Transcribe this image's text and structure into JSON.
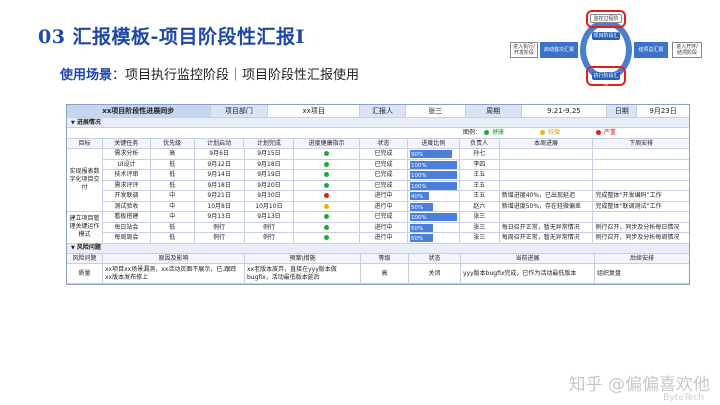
{
  "slide": {
    "title": "03 汇报模板-项目阶段性汇报I",
    "subtitle_label": "使用场景",
    "subtitle_text": "：项目执行监控阶段｜项目阶段性汇报使用",
    "watermark": "知乎 @偏偏喜欢他",
    "watermark_sub": "ByteTech"
  },
  "diagram": {
    "left_box": "进入执行/开发阶段",
    "start_label": "启动首次汇报",
    "top_label": "监控过程阶",
    "ring_top": "项目阶段汇报",
    "ring_bottom": "执行阶段汇报",
    "bottom_label": "执行阶段汇报",
    "end_label": "结项总汇报",
    "right_box": "进入开环/结项阶段"
  },
  "header": {
    "sheet_title": "xx项目阶段性进展同步",
    "dept_label": "项目部门",
    "dept_value": "xx项目",
    "reporter_label": "汇报人",
    "reporter_value": "张三",
    "period_label": "周期",
    "period_value": "9.21-9.25",
    "date_label": "日期",
    "date_value": "9月23日"
  },
  "progress_section": {
    "title": "进展情况",
    "legend_label": "图例：",
    "legend_green": "健康",
    "legend_yellow": "轻微",
    "legend_red": "严重",
    "columns": [
      "目标",
      "关键任务",
      "优先级",
      "计划启动",
      "计划完成",
      "进度健康指示",
      "状态",
      "进度比例",
      "负责人",
      "本周进展",
      "下周安排"
    ],
    "group1_target": "实现报表数字化项目交付",
    "group2_target": "建立项目管理关键运作模式",
    "rows": [
      {
        "task": "需求分析",
        "priority": "高",
        "start": "9月6日",
        "end": "9月15日",
        "health": "green",
        "status": "已完成",
        "progress": 90,
        "progress_label": "90%",
        "owner": "孙七",
        "this_week": "",
        "next_week": ""
      },
      {
        "task": "UI设计",
        "priority": "低",
        "start": "9月12日",
        "end": "9月18日",
        "health": "green",
        "status": "已完成",
        "progress": 100,
        "progress_label": "100%",
        "owner": "李四",
        "this_week": "",
        "next_week": ""
      },
      {
        "task": "技术评审",
        "priority": "低",
        "start": "9月14日",
        "end": "9月19日",
        "health": "green",
        "status": "已完成",
        "progress": 100,
        "progress_label": "100%",
        "owner": "王五",
        "this_week": "",
        "next_week": ""
      },
      {
        "task": "需求评评",
        "priority": "低",
        "start": "9月18日",
        "end": "9月20日",
        "health": "green",
        "status": "已完成",
        "progress": 100,
        "progress_label": "100%",
        "owner": "王五",
        "this_week": "",
        "next_week": ""
      },
      {
        "task": "开发联调",
        "priority": "中",
        "start": "9月21日",
        "end": "9月30日",
        "health": "red",
        "status": "进行中",
        "progress": 40,
        "progress_label": "40%",
        "owner": "王五",
        "this_week": "新增进度40%，已出现延迟",
        "next_week": "完成整体“开发编码”工作"
      },
      {
        "task": "测试验收",
        "priority": "中",
        "start": "10月8日",
        "end": "10月10日",
        "health": "yellow",
        "status": "进行中",
        "progress": 50,
        "progress_label": "50%",
        "owner": "赵六",
        "this_week": "新增进度50%，存在轻微偏差",
        "next_week": "完成整体“联调测试”工作"
      },
      {
        "task": "看板搭建",
        "priority": "中",
        "start": "9月13日",
        "end": "9月13日",
        "health": "green",
        "status": "已完成",
        "progress": 100,
        "progress_label": "100%",
        "owner": "张三",
        "this_week": "",
        "next_week": ""
      },
      {
        "task": "每日站会",
        "priority": "低",
        "start": "例行",
        "end": "例行",
        "health": "green",
        "status": "进行中",
        "progress": 50,
        "progress_label": "50%",
        "owner": "张三",
        "this_week": "每日召开正常，暂无异常情况",
        "next_week": "例行召开，同步及分析每日情况"
      },
      {
        "task": "每周周会",
        "priority": "低",
        "start": "例行",
        "end": "例行",
        "health": "green",
        "status": "进行中",
        "progress": 50,
        "progress_label": "50%",
        "owner": "张三",
        "this_week": "每周召开正常，暂无异常情况",
        "next_week": "例行召开，同步及分析每周情况"
      }
    ]
  },
  "risk_section": {
    "title": "风险问题",
    "columns": [
      "风险问题",
      "原因及影响",
      "预案\\措施",
      "等级",
      "状态",
      "当前进展",
      "后续安排"
    ],
    "rows": [
      {
        "issue": "质量",
        "cause": "xx项目xx场景漏测，xx活动页面不展示，已.跟踪xx版本发布修上",
        "plan": "xx老版本废弃，直接在yyy版本做bugfix，活动最低版本延后",
        "level": "高",
        "status": "关闭",
        "progress": "yyy版本bugfix完成，已作为活动最低版本",
        "next": "组织复盘"
      }
    ]
  },
  "colors": {
    "title": "#1f47a8",
    "bar": "#4c7fd9",
    "header_bg": "#d9e4f5",
    "green": "#22a83a",
    "yellow": "#e8b800",
    "red": "#e02020"
  }
}
